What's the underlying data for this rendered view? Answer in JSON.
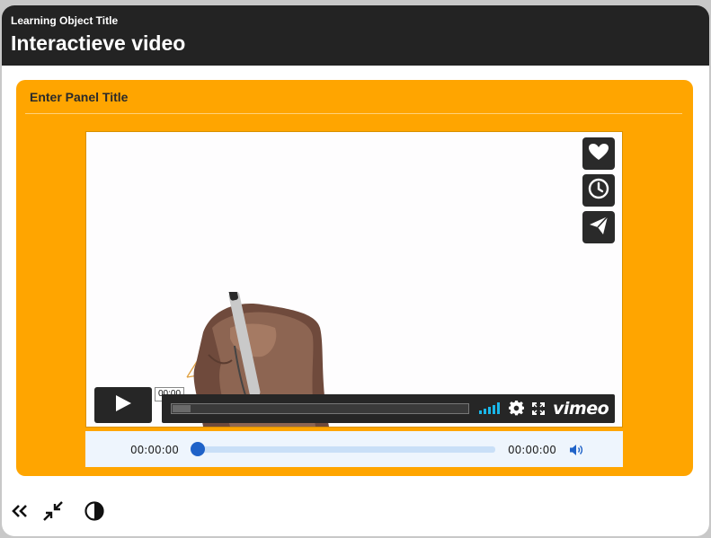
{
  "header": {
    "learning_object_title": "Learning Object Title",
    "page_title": "Interactieve video"
  },
  "panel": {
    "title": "Enter Panel Title"
  },
  "video": {
    "side_buttons": [
      "heart-icon",
      "clock-icon",
      "send-icon"
    ],
    "time_tooltip": "00:00",
    "brand": "vimeo",
    "progress_loaded_fraction": 0.06,
    "accent_color": "#1ab7ea"
  },
  "audio": {
    "current_time": "00:00:00",
    "duration": "00:00:00",
    "progress_fraction": 0.03,
    "accent_color": "#1f62c8"
  },
  "footer": {
    "icons": [
      "double-chevron-left-icon",
      "collapse-icon",
      "contrast-icon"
    ]
  },
  "colors": {
    "header_bg": "#232323",
    "panel_bg": "#ffa500"
  }
}
